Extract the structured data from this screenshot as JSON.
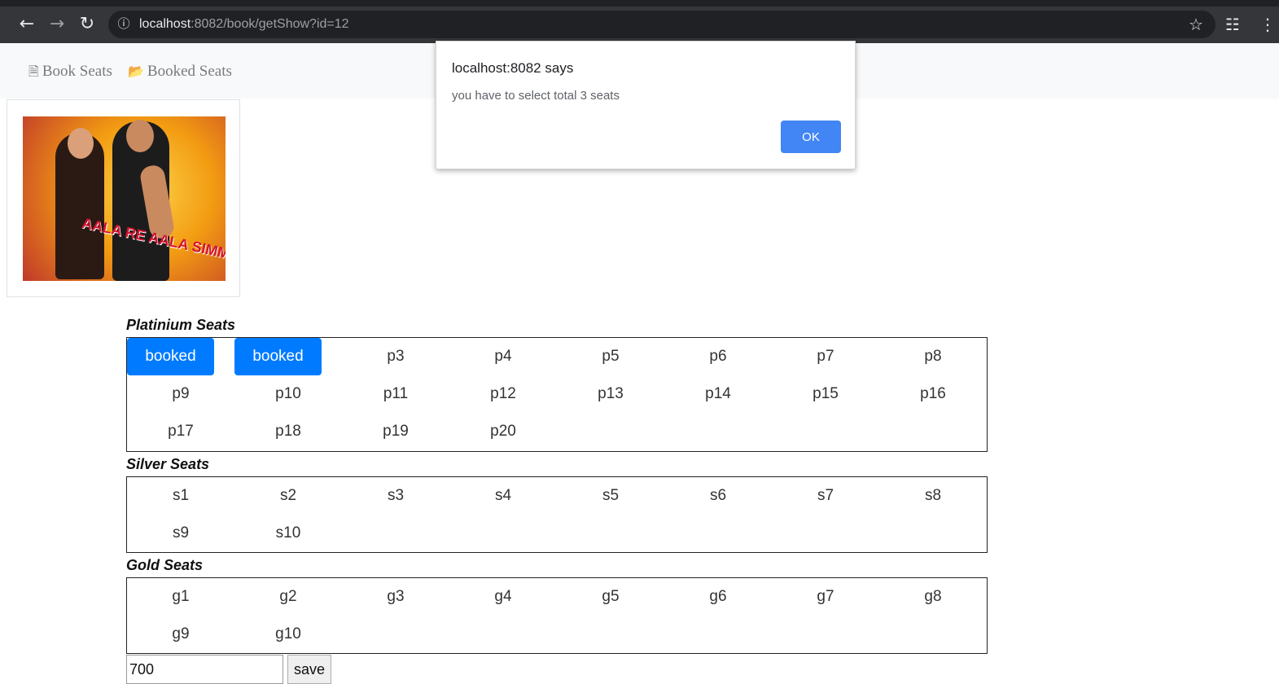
{
  "browser": {
    "back_icon": "arrow-left-icon",
    "forward_icon": "arrow-right-icon",
    "reload_icon": "reload-icon",
    "info_icon": "info-icon",
    "url_host": "localhost",
    "url_rest": ":8082/book/getShow?id=12",
    "star_icon": "star-icon",
    "incognito_icon": "incognito-icon",
    "menu_icon": "kebab-menu-icon"
  },
  "navbar": {
    "items": [
      {
        "label": "Book Seats",
        "icon": "document-icon"
      },
      {
        "label": "Booked Seats",
        "icon": "folder-open-icon"
      }
    ]
  },
  "poster": {
    "title": "AALA RE AALA SIMMBA AALA"
  },
  "sections": [
    {
      "label": "Platinium Seats",
      "seats": [
        {
          "label": "booked",
          "booked": true
        },
        {
          "label": "booked",
          "booked": true
        },
        {
          "label": "p3"
        },
        {
          "label": "p4"
        },
        {
          "label": "p5"
        },
        {
          "label": "p6"
        },
        {
          "label": "p7"
        },
        {
          "label": "p8"
        },
        {
          "label": "p9"
        },
        {
          "label": "p10"
        },
        {
          "label": "p11"
        },
        {
          "label": "p12"
        },
        {
          "label": "p13"
        },
        {
          "label": "p14"
        },
        {
          "label": "p15"
        },
        {
          "label": "p16"
        },
        {
          "label": "p17"
        },
        {
          "label": "p18"
        },
        {
          "label": "p19"
        },
        {
          "label": "p20"
        }
      ]
    },
    {
      "label": "Silver Seats",
      "seats": [
        {
          "label": "s1"
        },
        {
          "label": "s2"
        },
        {
          "label": "s3"
        },
        {
          "label": "s4"
        },
        {
          "label": "s5"
        },
        {
          "label": "s6"
        },
        {
          "label": "s7"
        },
        {
          "label": "s8"
        },
        {
          "label": "s9"
        },
        {
          "label": "s10"
        }
      ]
    },
    {
      "label": "Gold Seats",
      "seats": [
        {
          "label": "g1"
        },
        {
          "label": "g2"
        },
        {
          "label": "g3"
        },
        {
          "label": "g4"
        },
        {
          "label": "g5"
        },
        {
          "label": "g6"
        },
        {
          "label": "g7"
        },
        {
          "label": "g8"
        },
        {
          "label": "g9"
        },
        {
          "label": "g10"
        }
      ]
    }
  ],
  "form": {
    "total_value": "700",
    "save_label": "save"
  },
  "dialog": {
    "title": "localhost:8082 says",
    "message": "you have to select total 3 seats",
    "ok_label": "OK"
  },
  "colors": {
    "booked": "#007bff",
    "dialog_button": "#4285f4",
    "chrome": "#35363a"
  }
}
